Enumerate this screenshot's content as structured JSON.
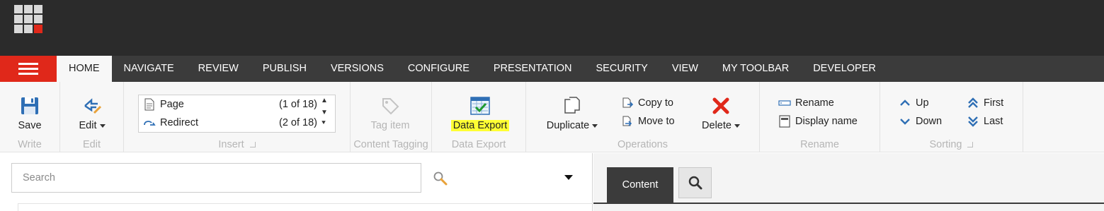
{
  "tabs": [
    "HOME",
    "NAVIGATE",
    "REVIEW",
    "PUBLISH",
    "VERSIONS",
    "CONFIGURE",
    "PRESENTATION",
    "SECURITY",
    "VIEW",
    "MY TOOLBAR",
    "DEVELOPER"
  ],
  "active_tab": "HOME",
  "ribbon": {
    "write": {
      "save": "Save",
      "label": "Write"
    },
    "edit": {
      "edit": "Edit",
      "label": "Edit"
    },
    "insert": {
      "items": [
        {
          "name": "Page",
          "count": "(1 of 18)",
          "icon": "page-icon"
        },
        {
          "name": "Redirect",
          "count": "(2 of 18)",
          "icon": "redirect-icon"
        }
      ],
      "label": "Insert"
    },
    "content_tagging": {
      "tag_item": "Tag item",
      "label": "Content Tagging"
    },
    "data_export": {
      "button": "Data Export",
      "label": "Data Export",
      "highlight_color": "#ffff33"
    },
    "operations": {
      "duplicate": "Duplicate",
      "copy_to": "Copy to",
      "move_to": "Move to",
      "delete": "Delete",
      "label": "Operations"
    },
    "rename": {
      "rename": "Rename",
      "display_name": "Display name",
      "label": "Rename"
    },
    "sorting": {
      "up": "Up",
      "down": "Down",
      "first": "First",
      "last": "Last",
      "label": "Sorting"
    }
  },
  "search": {
    "placeholder": "Search"
  },
  "editor": {
    "content_tab": "Content"
  },
  "colors": {
    "brand_red": "#e0281a",
    "topbar": "#2b2b2b",
    "accent_blue": "#2f6fb5"
  }
}
